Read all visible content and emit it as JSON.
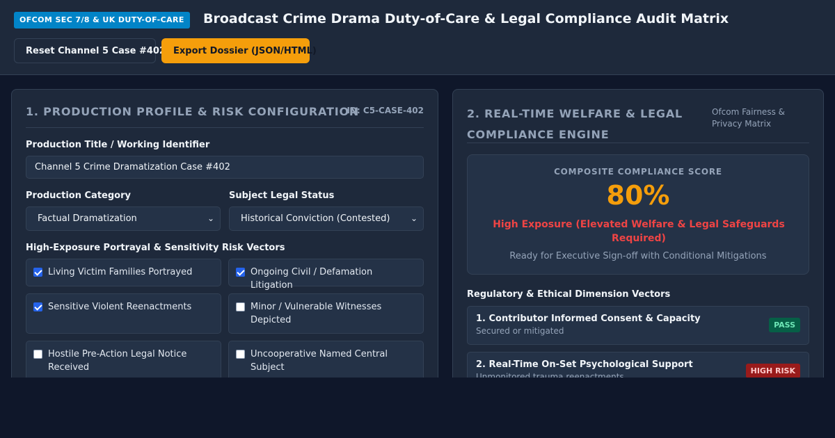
{
  "header": {
    "badge": "OFCOM SEC 7/8 & UK DUTY-OF-CARE",
    "title": "Broadcast Crime Drama Duty-of-Care & Legal Compliance Audit Matrix",
    "reset_label": "Reset Channel 5 Case #402",
    "export_label": "Export Dossier (JSON/HTML)"
  },
  "profile": {
    "title": "1. PRODUCTION PROFILE & RISK CONFIGURATION",
    "case_id": "ID: C5-CASE-402",
    "title_label": "Production Title / Working Identifier",
    "title_value": "Channel 5 Crime Dramatization Case #402",
    "category_label": "Production Category",
    "category_value": "Factual Dramatization",
    "status_label": "Subject Legal Status",
    "status_value": "Historical Conviction (Contested)",
    "vectors_label": "High-Exposure Portrayal & Sensitivity Risk Vectors",
    "risk_vectors": [
      {
        "label": "Living Victim Families Portrayed",
        "checked": true
      },
      {
        "label": "Ongoing Civil / Defamation Litigation",
        "checked": true
      },
      {
        "label": "Sensitive Violent Reenactments",
        "checked": true
      },
      {
        "label": "Minor / Vulnerable Witnesses Depicted",
        "checked": false
      },
      {
        "label": "Hostile Pre-Action Legal Notice Received",
        "checked": false
      },
      {
        "label": "Uncooperative Named Central Subject",
        "checked": false
      }
    ]
  },
  "engine": {
    "title": "2. REAL-TIME WELFARE & LEGAL COMPLIANCE ENGINE",
    "subtitle": "Ofcom Fairness & Privacy Matrix",
    "score_label": "COMPOSITE COMPLIANCE SCORE",
    "score_value": "80%",
    "score_status": "High Exposure (Elevated Welfare & Legal Safeguards Required)",
    "score_note": "Ready for Executive Sign-off with Conditional Mitigations",
    "vectors_heading": "Regulatory & Ethical Dimension Vectors",
    "vectors": [
      {
        "title": "1. Contributor Informed Consent & Capacity",
        "desc": "Secured or mitigated",
        "status": "PASS"
      },
      {
        "title": "2. Real-Time On-Set Psychological Support",
        "desc": "Unmonitored trauma reenactments",
        "status": "HIGH RISK"
      }
    ]
  },
  "colors": {
    "accent": "#f59e0b",
    "badge": "#0284c7",
    "danger": "#ef4444",
    "pass": "#065f46",
    "risk": "#991b1b"
  }
}
